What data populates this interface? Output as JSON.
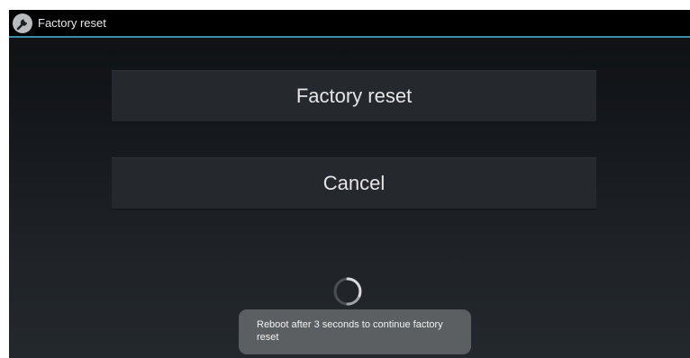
{
  "titlebar": {
    "title": "Factory reset",
    "icon": "wrench-icon"
  },
  "buttons": {
    "factory_reset_label": "Factory reset",
    "cancel_label": "Cancel"
  },
  "progress": {
    "icon": "spinner-icon"
  },
  "toast": {
    "message": "Reboot after 3 seconds to continue factory reset"
  },
  "colors": {
    "accent": "#3a8fa8",
    "titlebar_bg": "#000000",
    "button_bg": "#25292d",
    "toast_bg": "#626467"
  }
}
